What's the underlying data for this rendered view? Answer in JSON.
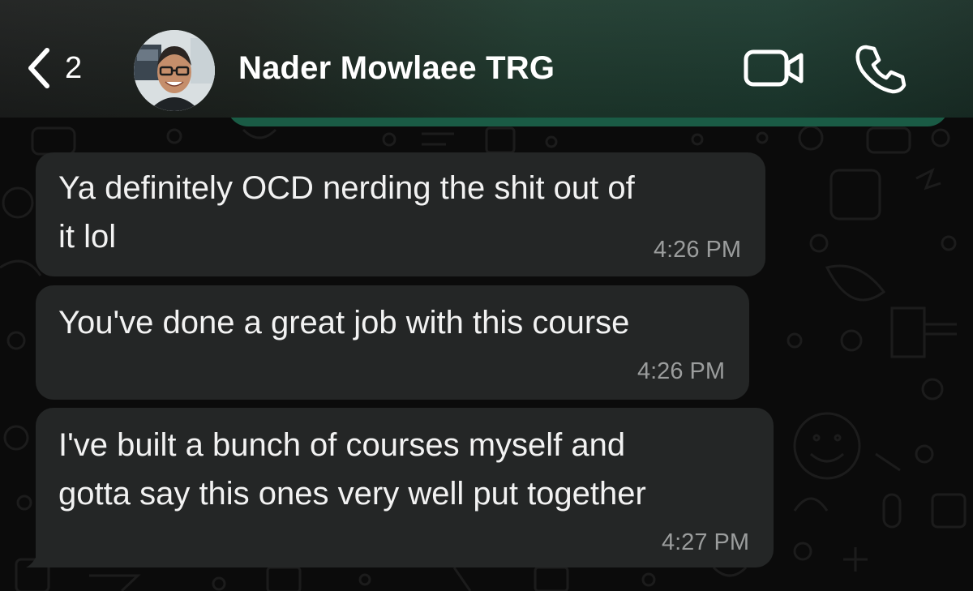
{
  "header": {
    "back_count": "2",
    "contact_name": "Nader Mowlaee TRG",
    "icons": {
      "back": "chevron-left-icon",
      "video": "video-camera-icon",
      "call": "phone-icon"
    }
  },
  "messages": [
    {
      "text": "Ya definitely OCD nerding the shit out of\nit lol",
      "time": "4:26 PM"
    },
    {
      "text": "You've done a great job with this course",
      "time": "4:26 PM"
    },
    {
      "text": "I've built a bunch of courses myself and\ngotta say this ones very well put together",
      "time": "4:27 PM"
    }
  ],
  "colors": {
    "incoming_bubble": "#242626",
    "header_accent": "#1f3a2e",
    "outgoing_bubble": "#1a5b45",
    "timestamp": "#9b9d9d",
    "background": "#0b0b0b"
  }
}
